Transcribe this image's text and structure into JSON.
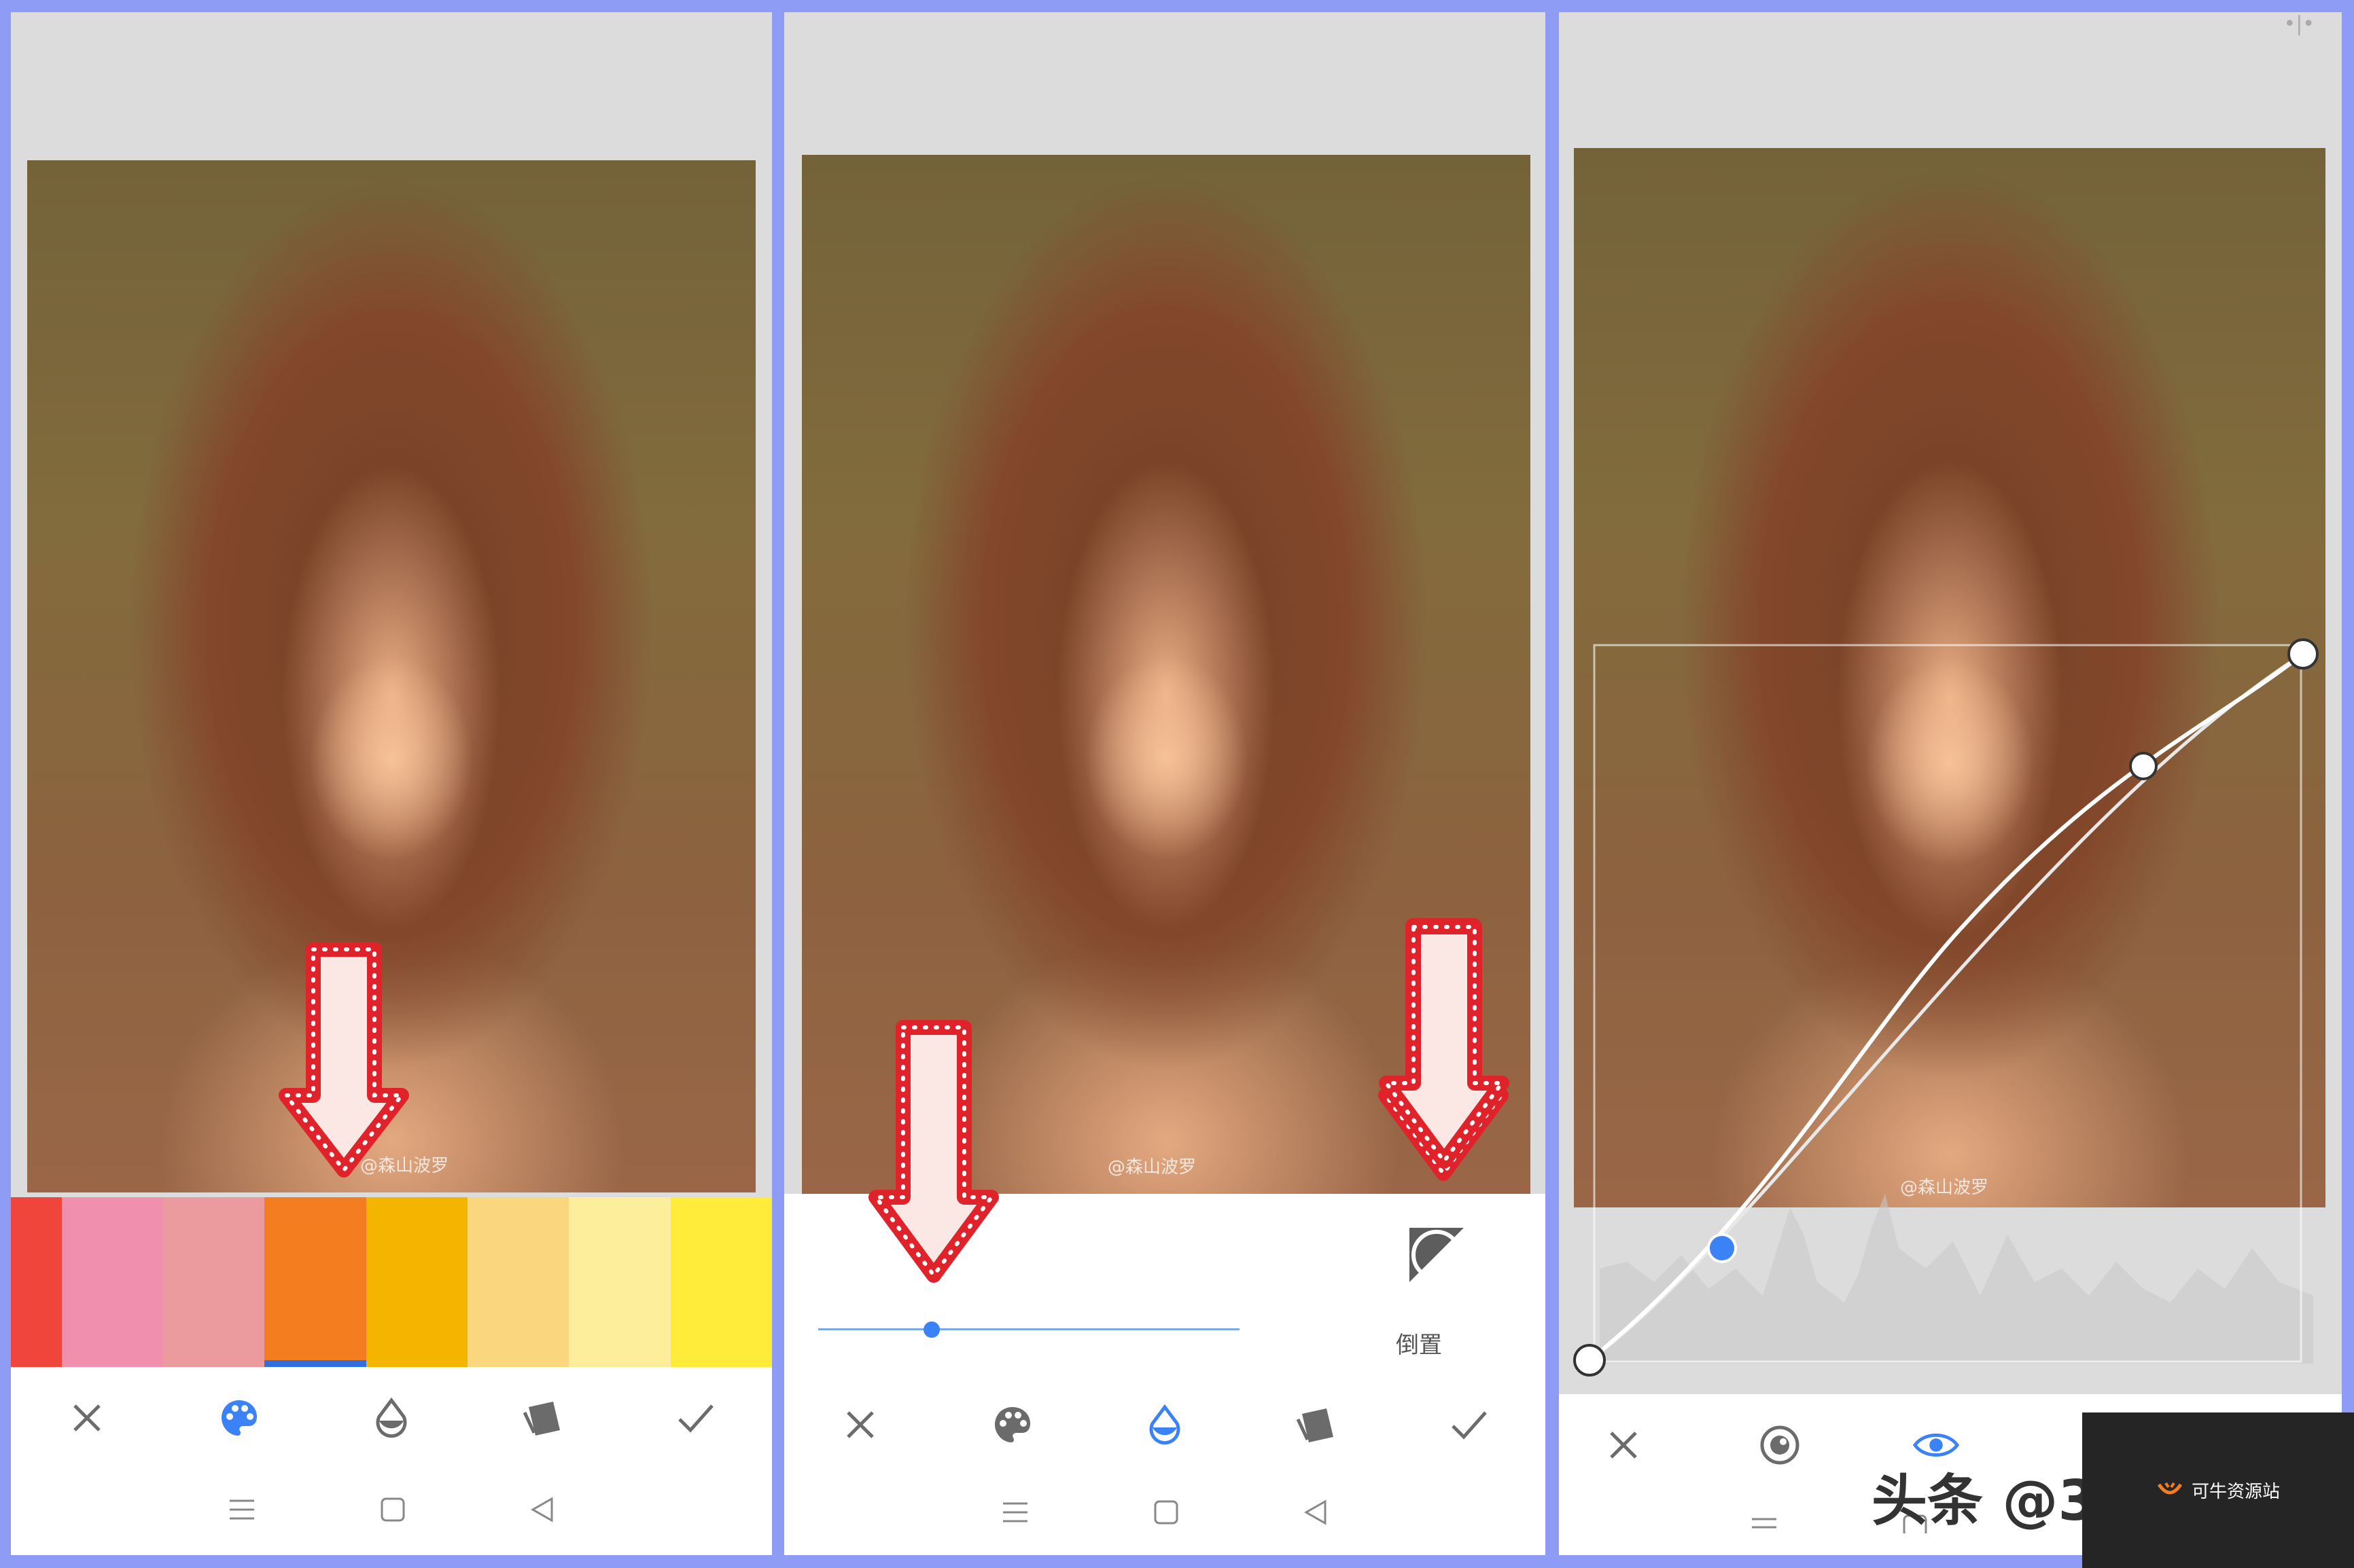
{
  "panel1": {
    "watermark": "@森山波罗",
    "swatch_colors": [
      "#f0453b",
      "#f090ae",
      "#eb9b9e",
      "#f47d20",
      "#f5b400",
      "#fad77e",
      "#fdee9c",
      "#feeb3a"
    ],
    "selected_swatch": 3,
    "tools": [
      "close-icon",
      "palette-icon",
      "drop-icon",
      "layers-icon",
      "check-icon"
    ],
    "active_tool": "palette-icon"
  },
  "panel2": {
    "watermark": "@森山波罗",
    "slider_value": 0.27,
    "invert_label": "倒置",
    "tools": [
      "close-icon",
      "palette-icon",
      "drop-icon",
      "layers-icon",
      "check-icon"
    ],
    "active_tool": "drop-icon"
  },
  "panel3": {
    "watermark": "@森山波罗",
    "tools": [
      "close-icon",
      "swirl-icon",
      "eye-icon"
    ],
    "active_tool": "eye-icon",
    "toutiao_text": "头条 @3"
  },
  "footer_badge": {
    "text": "可牛资源站"
  },
  "colors": {
    "accent": "#3b82f6",
    "border": "#8f9cf6",
    "arrow_red": "#e0222a"
  }
}
